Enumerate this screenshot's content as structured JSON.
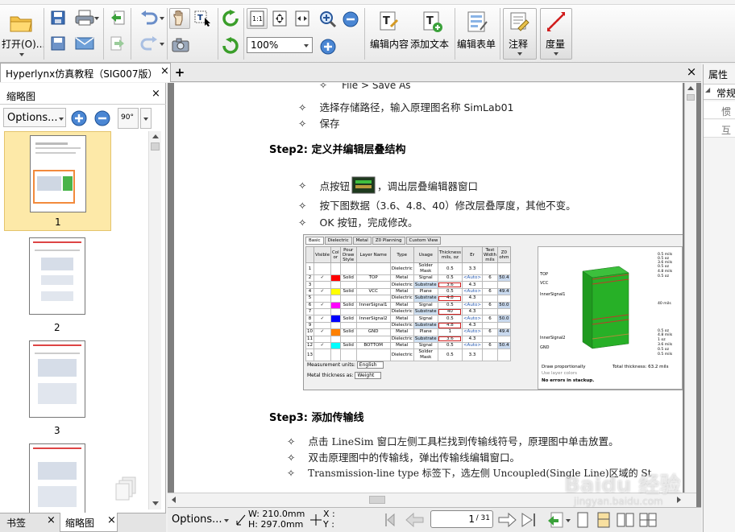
{
  "toolbar": {
    "open_label": "打开(O)...",
    "zoom_value": "100%",
    "edit_content_label": "编辑内容",
    "add_text_label": "添加文本",
    "edit_form_label": "编辑表单",
    "annotate_label": "注释",
    "measure_label": "度量"
  },
  "tabs": {
    "doc_tab": "Hyperlynx仿真教程（SIG007版）",
    "close_glyph": "×",
    "add_glyph": "+"
  },
  "thumbnail_panel": {
    "title": "缩略图",
    "options_label": "Options...",
    "rotate_label": "90°",
    "pages": [
      "1",
      "2",
      "3"
    ]
  },
  "bottom_tabs": {
    "bookmarks": "书签",
    "thumbnails": "缩略图"
  },
  "right_panel": {
    "title": "属性",
    "row1": "常规",
    "row2": "惯",
    "row3": "互"
  },
  "document": {
    "top_cut": "File > Save As",
    "bullets_step1": [
      "选择存储路径，输入原理图名称 SimLab01",
      "保存"
    ],
    "step2_title": "Step2: 定义并编辑层叠结构",
    "step2_bullet1_pre": "点按钮",
    "step2_bullet1_post": "，调出层叠编辑器窗口",
    "step2_bullet2": "按下图数据（3.6、4.8、40）修改层叠厚度，其他不变。",
    "step2_bullet3": "OK 按钮，完成修改。",
    "step3_title": "Step3: 添加传输线",
    "bullets_step3": [
      "点击 LineSim 窗口左侧工具栏找到传输线符号，原理图中单击放置。",
      "双击原理图中的传输线，弹出传输线编辑窗口。",
      "Transmission-line type 标签下，选左侧 Uncoupled(Single Line)区域的 St"
    ],
    "bullet_glyph": "✧"
  },
  "stackup": {
    "tabs": [
      "Basic",
      "Dielectric",
      "Metal",
      "Z0 Planning",
      "Custom View"
    ],
    "headers": [
      "",
      "Visible",
      "Col or",
      "Pour Draw Style",
      "Layer Name",
      "Type",
      "Usage",
      "Thickness mils, oz",
      "Er",
      "Test Width mils",
      "Z0 ohm"
    ],
    "rows": [
      [
        "1",
        "",
        "",
        "",
        "",
        "Dielectric",
        "Solder Mask",
        "0.5",
        "3.3",
        "",
        ""
      ],
      [
        "2",
        "✓",
        "#ff0000",
        "Solid",
        "TOP",
        "Metal",
        "Signal",
        "0.5",
        "<Auto>",
        "6",
        "50.4"
      ],
      [
        "3",
        "",
        "",
        "",
        "",
        "Dielectric",
        "Substrate",
        "3.6",
        "4.3",
        "",
        ""
      ],
      [
        "4",
        "✓",
        "#ffff00",
        "Solid",
        "VCC",
        "Metal",
        "Plane",
        "0.5",
        "<Auto>",
        "6",
        "49.4"
      ],
      [
        "5",
        "",
        "",
        "",
        "",
        "Dielectric",
        "Substrate",
        "4.8",
        "4.3",
        "",
        ""
      ],
      [
        "6",
        "✓",
        "#ff00ff",
        "Solid",
        "InnerSignal1",
        "Metal",
        "Signal",
        "0.5",
        "<Auto>",
        "6",
        "50.0"
      ],
      [
        "7",
        "",
        "",
        "",
        "",
        "Dielectric",
        "Substrate",
        "40",
        "4.3",
        "",
        ""
      ],
      [
        "8",
        "✓",
        "#0000ff",
        "Solid",
        "InnerSignal2",
        "Metal",
        "Signal",
        "0.5",
        "<Auto>",
        "6",
        "50.0"
      ],
      [
        "9",
        "",
        "",
        "",
        "",
        "Dielectric",
        "Substrate",
        "4.8",
        "4.3",
        "",
        ""
      ],
      [
        "10",
        "✓",
        "#ff8000",
        "Solid",
        "GND",
        "Metal",
        "Plane",
        "1",
        "<Auto>",
        "6",
        "49.4"
      ],
      [
        "11",
        "",
        "",
        "",
        "",
        "Dielectric",
        "Substrate",
        "3.6",
        "4.3",
        "",
        ""
      ],
      [
        "12",
        "✓",
        "#00ffff",
        "Solid",
        "BOTTOM",
        "Metal",
        "Signal",
        "0.5",
        "<Auto>",
        "6",
        "50.4"
      ],
      [
        "13",
        "",
        "",
        "",
        "",
        "Dielectric",
        "Solder Mask",
        "0.5",
        "3.3",
        "",
        ""
      ]
    ],
    "measurement_label": "Measurement units:",
    "measurement_value": "English",
    "metal_label": "Metal thickness as:",
    "metal_value": "Weight",
    "left_labels": [
      "TOP",
      "VCC",
      "InnerSignal1",
      "InnerSignal2",
      "GND"
    ],
    "right_labels": [
      "0.5 mils",
      "0.5 oz",
      "3.6 mils",
      "0.5 oz",
      "4.8 mils",
      "0.5 oz",
      "40 mils",
      "0.5 oz",
      "4.8 mils",
      "1 oz",
      "3.6 mils",
      "0.5 oz",
      "0.5 mils"
    ],
    "draw_prop": "Draw proportionally",
    "layer_colors": "Use layer colors",
    "no_errors": "No errors in stackup.",
    "total": "Total thickness: 63.2 mils"
  },
  "status": {
    "options_label": "Options...",
    "width": "W: 210.0mm",
    "height": "H: 297.0mm",
    "x_label": "X :",
    "y_label": "Y :",
    "page_value": "1",
    "page_total": "/ 31"
  },
  "watermark": "Baidu 经验",
  "watermark_sub": "jingyan.baidu.com"
}
